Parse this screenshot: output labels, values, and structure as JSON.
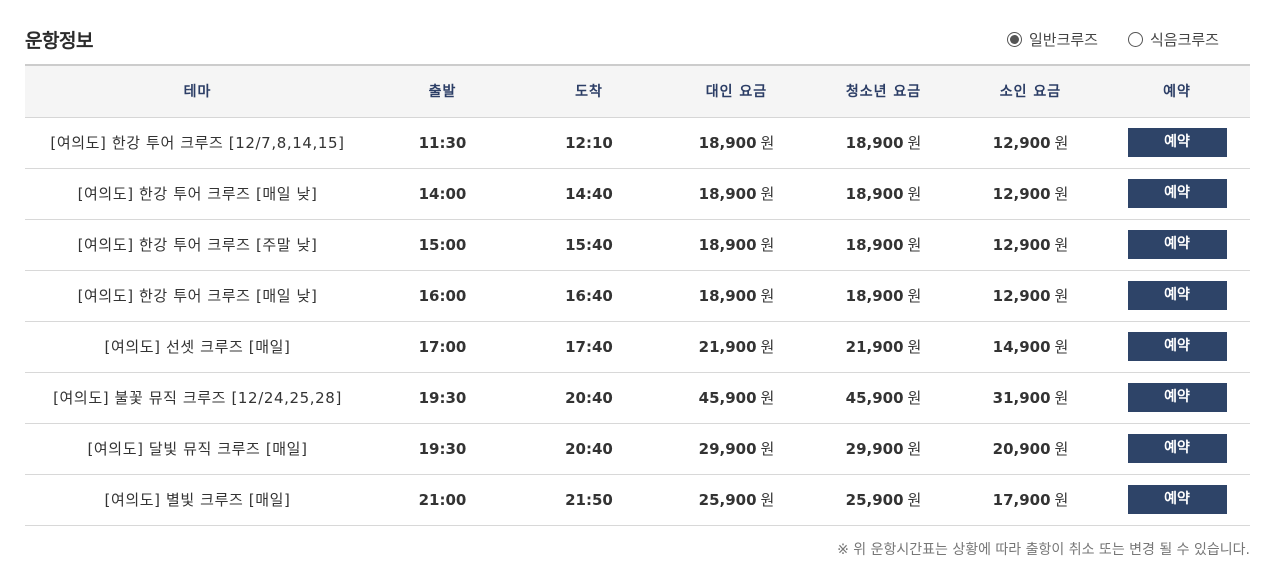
{
  "title": "운항정보",
  "radio": {
    "options": [
      {
        "label": "일반크루즈",
        "checked": true
      },
      {
        "label": "식음크루즈",
        "checked": false
      }
    ]
  },
  "table": {
    "headers": [
      "테마",
      "출발",
      "도착",
      "대인 요금",
      "청소년 요금",
      "소인 요금",
      "예약"
    ],
    "rows": [
      {
        "theme": "[여의도] 한강 투어 크루즈 [12/7,8,14,15]",
        "depart": "11:30",
        "arrive": "12:10",
        "adult": "18,900",
        "youth": "18,900",
        "child": "12,900",
        "button": "예약"
      },
      {
        "theme": "[여의도] 한강 투어 크루즈 [매일 낮]",
        "depart": "14:00",
        "arrive": "14:40",
        "adult": "18,900",
        "youth": "18,900",
        "child": "12,900",
        "button": "예약"
      },
      {
        "theme": "[여의도] 한강 투어 크루즈 [주말 낮]",
        "depart": "15:00",
        "arrive": "15:40",
        "adult": "18,900",
        "youth": "18,900",
        "child": "12,900",
        "button": "예약"
      },
      {
        "theme": "[여의도] 한강 투어 크루즈 [매일 낮]",
        "depart": "16:00",
        "arrive": "16:40",
        "adult": "18,900",
        "youth": "18,900",
        "child": "12,900",
        "button": "예약"
      },
      {
        "theme": "[여의도] 선셋 크루즈 [매일]",
        "depart": "17:00",
        "arrive": "17:40",
        "adult": "21,900",
        "youth": "21,900",
        "child": "14,900",
        "button": "예약"
      },
      {
        "theme": "[여의도] 불꽃 뮤직 크루즈 [12/24,25,28]",
        "depart": "19:30",
        "arrive": "20:40",
        "adult": "45,900",
        "youth": "45,900",
        "child": "31,900",
        "button": "예약"
      },
      {
        "theme": "[여의도] 달빛 뮤직 크루즈 [매일]",
        "depart": "19:30",
        "arrive": "20:40",
        "adult": "29,900",
        "youth": "29,900",
        "child": "20,900",
        "button": "예약"
      },
      {
        "theme": "[여의도] 별빛 크루즈 [매일]",
        "depart": "21:00",
        "arrive": "21:50",
        "adult": "25,900",
        "youth": "25,900",
        "child": "17,900",
        "button": "예약"
      }
    ],
    "currency_unit": "원"
  },
  "notice": "※ 위 운항시간표는 상황에 따라 출항이 취소 또는 변경 될 수 있습니다.",
  "colors": {
    "button_bg": "#2e4468",
    "header_text": "#2c3e66",
    "header_bg": "#f5f5f5"
  }
}
